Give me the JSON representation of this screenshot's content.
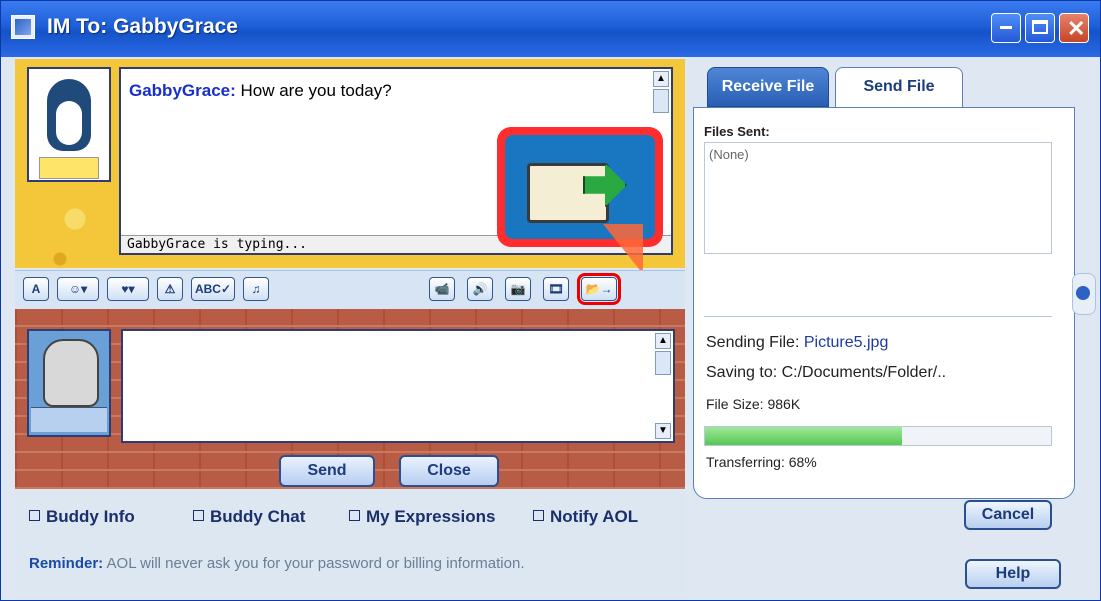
{
  "window": {
    "title": "IM To: GabbyGrace",
    "controls": [
      "minimize",
      "maximize",
      "close"
    ]
  },
  "chat": {
    "messages": [
      {
        "sender": "GabbyGrace:",
        "text": "How are you today?"
      }
    ],
    "status": "GabbyGrace is typing..."
  },
  "toolbar": {
    "left_buttons": [
      {
        "name": "font-button",
        "label": "A"
      },
      {
        "name": "smiley-button",
        "label": "☺▾"
      },
      {
        "name": "heart-button",
        "label": "♥▾"
      },
      {
        "name": "warn-button",
        "label": "⚠"
      },
      {
        "name": "spellcheck-button",
        "label": "ABC✓"
      },
      {
        "name": "music-button",
        "label": "♫"
      }
    ],
    "right_buttons": [
      {
        "name": "video-button",
        "label": "📹"
      },
      {
        "name": "talk-button",
        "label": "🔊"
      },
      {
        "name": "camera-button",
        "label": "📷"
      },
      {
        "name": "film-button",
        "label": "🎞"
      },
      {
        "name": "send-file-button",
        "label": "📂→"
      }
    ]
  },
  "actions": {
    "send": "Send",
    "close": "Close"
  },
  "links": {
    "buddy_info": "Buddy Info",
    "buddy_chat": "Buddy Chat",
    "my_expressions": "My Expressions",
    "notify_aol": "Notify AOL"
  },
  "reminder": {
    "label": "Reminder:",
    "text": "AOL will never ask you for your password or billing information."
  },
  "file_panel": {
    "tabs": [
      "Receive File",
      "Send File"
    ],
    "active_tab": "Send File",
    "files_sent_label": "Files Sent:",
    "files_sent_value": "(None)",
    "sending_label": "Sending File:",
    "sending_value": "Picture5.jpg",
    "saving_label": "Saving to:",
    "saving_value": "C:/Documents/Folder/..",
    "size_label": "File Size:",
    "size_value": "986K",
    "progress_fraction": 0.57,
    "transferring_text": "Transferring: 68%",
    "cancel": "Cancel",
    "help": "Help"
  }
}
